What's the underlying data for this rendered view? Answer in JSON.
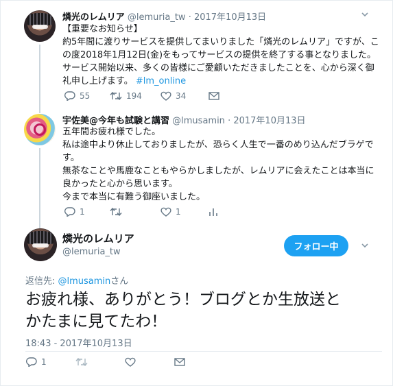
{
  "tweet1": {
    "display_name": "燐光のレムリア",
    "handle": "@lemuria_tw",
    "date": "· 2017年10月13日",
    "lines": [
      "【重要なお知らせ】",
      "約5年間に渡りサービスを提供してまいりました「燐光のレムリア」ですが、こ",
      "の度2018年1月12日(金)をもってサービスの提供を終了する事となりました。",
      "サービス開始以来、多くの皆様にご愛顧いただきましたことを、心から深く御",
      "礼申し上げます。"
    ],
    "hashtag": "#lm_online",
    "replies": "55",
    "retweets": "194",
    "likes": "34"
  },
  "tweet2": {
    "display_name": "宇佐美@今年も試験と講習",
    "handle": "@lmusamin",
    "date": "· 2017年10月13日",
    "lines": [
      "五年間お疲れ様でした。",
      "私は途中より休止しておりましたが、恐らく人生で一番のめり込んだブラゲで",
      "す。",
      "無茶なことや馬鹿なこともやらかしましたが、レムリアに会えたことは本当に",
      "良かったと心から思います。",
      "今まで本当に有難う御座いました。"
    ],
    "replies": "1",
    "likes": "1"
  },
  "main_tweet": {
    "display_name": "燐光のレムリア",
    "handle": "@lemuria_tw",
    "follow_label": "フォロー中",
    "reply_prefix": "返信先: ",
    "reply_handle": "@lmusamin",
    "reply_suffix": "さん",
    "text_line1": "お疲れ様、ありがとう！ブログとか生放送と",
    "text_line2": "かたまに見てたわ！",
    "timestamp": "18:43 - 2017年10月13日",
    "replies": "1"
  },
  "colors": {
    "accent": "#1da1f2",
    "muted": "#657786",
    "link": "#1b95e0"
  },
  "icons": [
    "reply-icon",
    "retweet-icon",
    "like-icon",
    "dm-icon",
    "analytics-icon",
    "chevron-down-icon"
  ]
}
